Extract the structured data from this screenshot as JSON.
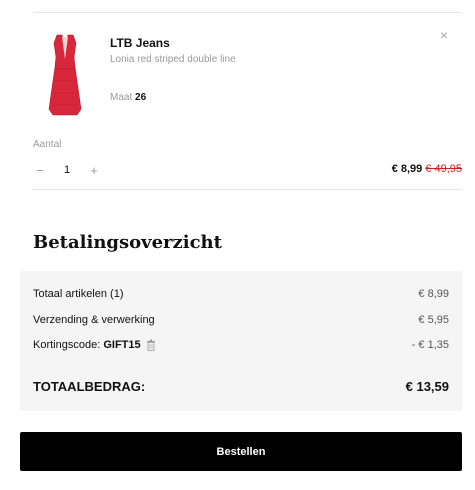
{
  "item": {
    "brand": "LTB Jeans",
    "name": "Lonia red striped double line",
    "size_label": "Maat",
    "size_value": "26",
    "qty_label": "Aantal",
    "qty_minus": "−",
    "qty_value": "1",
    "qty_plus": "+",
    "price_now": "€ 8,99",
    "price_old": "€ 49,95",
    "close_icon": "×",
    "thumb_color": "#d8263b"
  },
  "summary": {
    "title": "Betalingsoverzicht",
    "rows": [
      {
        "label": "Totaal artikelen (1)",
        "value": "€ 8,99"
      },
      {
        "label": "Verzending & verwerking",
        "value": "€ 5,95"
      },
      {
        "label_prefix": "Kortingscode:",
        "code": "GIFT15",
        "value": "- € 1,35",
        "icon": "trash-icon"
      }
    ],
    "total_label": "TOTAALBEDRAG:",
    "total_value": "€ 13,59"
  },
  "actions": {
    "order_label": "Bestellen"
  }
}
